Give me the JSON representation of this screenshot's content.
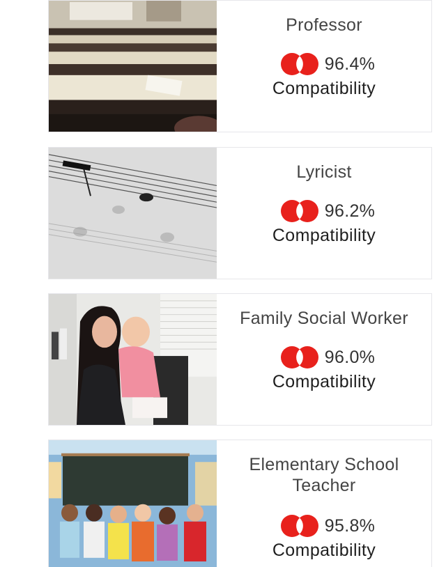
{
  "careers": [
    {
      "title": "Professor",
      "image": "lecture-hall-photo",
      "percent": "96.4%",
      "label": "Compatibility"
    },
    {
      "title": "Lyricist",
      "image": "sheet-music-photo",
      "percent": "96.2%",
      "label": "Compatibility"
    },
    {
      "title": "Family Social Worker",
      "image": "woman-holding-baby-photo",
      "percent": "96.0%",
      "label": "Compatibility"
    },
    {
      "title": "Elementary School Teacher",
      "image": "kids-at-chalkboard-photo",
      "percent": "95.8%",
      "label": "Compatibility"
    }
  ],
  "colors": {
    "accent_red": "#e8211c",
    "card_border": "#e6e6ea",
    "title_text": "#444444"
  },
  "icons": {
    "match": "overlapping-circles-icon"
  }
}
